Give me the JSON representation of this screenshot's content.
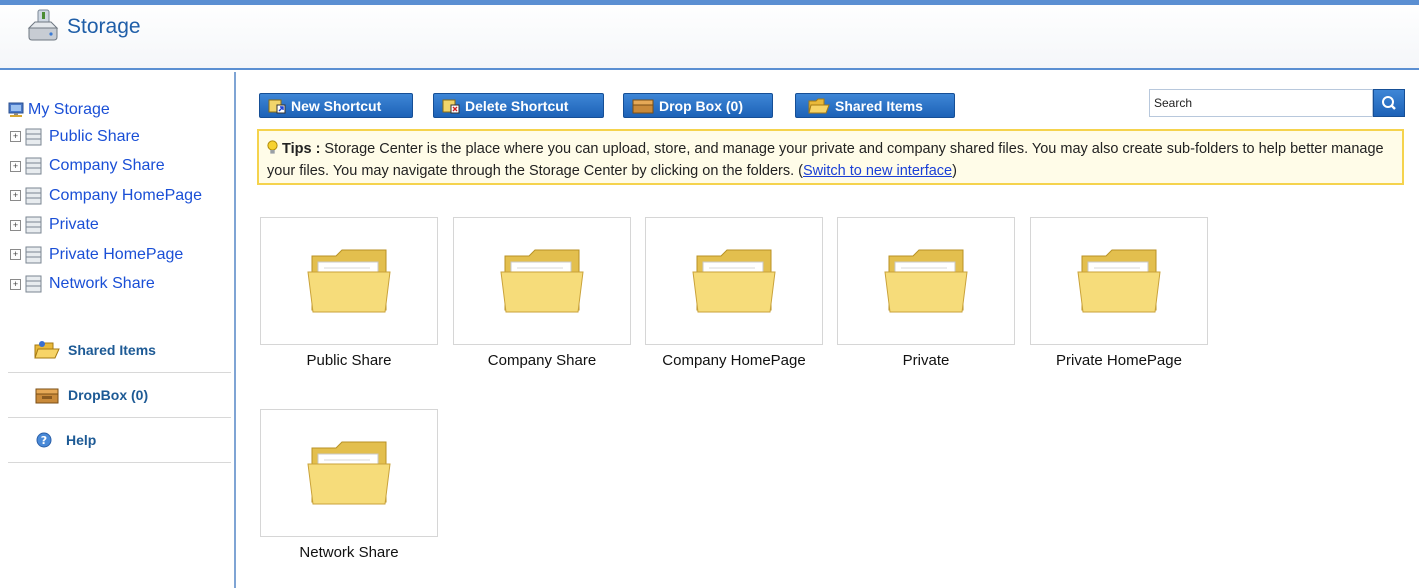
{
  "header": {
    "title": "Storage",
    "accent_color": "#5b8fd2"
  },
  "sidebar": {
    "root": {
      "label": "My Storage",
      "icon": "computer-icon"
    },
    "tree": [
      {
        "label": "Public Share"
      },
      {
        "label": "Company Share"
      },
      {
        "label": "Company HomePage"
      },
      {
        "label": "Private"
      },
      {
        "label": "Private HomePage"
      },
      {
        "label": "Network Share"
      }
    ],
    "links": [
      {
        "label": "Shared Items",
        "icon": "shared-folder-icon"
      },
      {
        "label": "DropBox (0)",
        "icon": "dropbox-icon"
      },
      {
        "label": "Help",
        "icon": "help-icon"
      }
    ]
  },
  "toolbar": {
    "new_shortcut": "New Shortcut",
    "delete_shortcut": "Delete Shortcut",
    "drop_box": "Drop Box (0)",
    "shared_items": "Shared Items",
    "button_color": "#2a73c8"
  },
  "search": {
    "value": "Search"
  },
  "tips": {
    "label": "Tips :",
    "text": " Storage Center is the place where you can upload, store, and manage your private and company shared files. You may also create sub-folders to help better manage your files. You may navigate through the Storage Center by clicking on the folders.  (",
    "link": "Switch to new interface",
    "suffix": ")"
  },
  "folders": [
    {
      "label": "Public Share"
    },
    {
      "label": "Company Share"
    },
    {
      "label": "Company HomePage"
    },
    {
      "label": "Private"
    },
    {
      "label": "Private HomePage"
    },
    {
      "label": "Network Share"
    }
  ]
}
